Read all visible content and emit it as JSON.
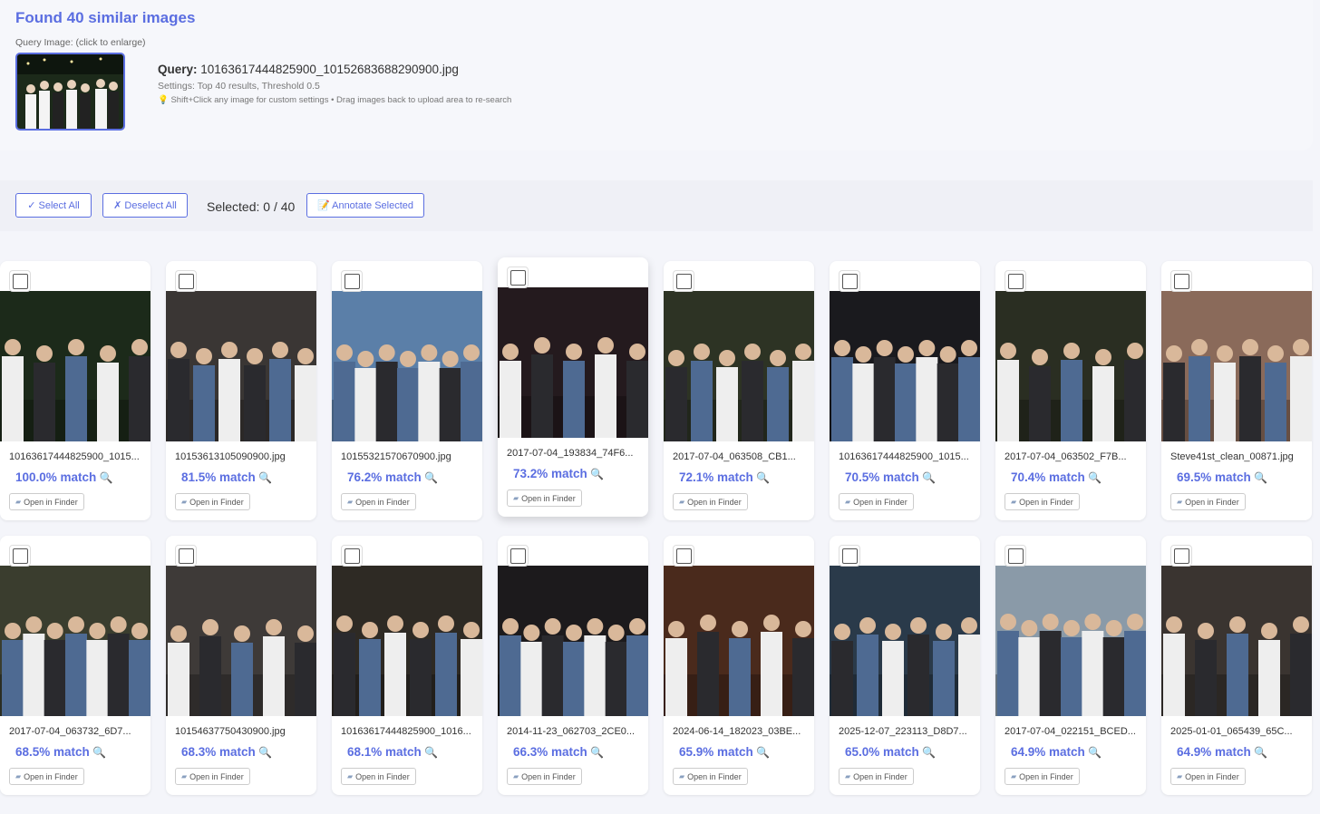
{
  "header": {
    "title": "Found 40 similar images",
    "query_label": "Query Image: (click to enlarge)",
    "query_prefix": "Query:",
    "query_filename": "10163617444825900_10152683688290900.jpg",
    "settings": "Settings: Top 40 results, Threshold 0.5",
    "tip": "💡 Shift+Click any image for custom settings • Drag images back to upload area to re-search"
  },
  "toolbar": {
    "select_all": "✓ Select All",
    "deselect_all": "✗ Deselect All",
    "selected": "Selected: 0 / 40",
    "annotate": "📝 Annotate Selected"
  },
  "open_in_finder": "Open in Finder",
  "results": [
    {
      "filename": "10163617444825900_1015...",
      "match": "100.0% match",
      "photo_color": "#1c2a1a"
    },
    {
      "filename": "10153613105090900.jpg",
      "match": "81.5% match",
      "photo_color": "#3a3634"
    },
    {
      "filename": "10155321570670900.jpg",
      "match": "76.2% match",
      "photo_color": "#5b7fa8"
    },
    {
      "filename": "2017-07-04_193834_74F6...",
      "match": "73.2% match",
      "photo_color": "#241a1e"
    },
    {
      "filename": "2017-07-04_063508_CB1...",
      "match": "72.1% match",
      "photo_color": "#2d3324"
    },
    {
      "filename": "10163617444825900_1015...",
      "match": "70.5% match",
      "photo_color": "#1a1a1e"
    },
    {
      "filename": "2017-07-04_063502_F7B...",
      "match": "70.4% match",
      "photo_color": "#2a2e22"
    },
    {
      "filename": "Steve41st_clean_00871.jpg",
      "match": "69.5% match",
      "photo_color": "#8a6a5a"
    },
    {
      "filename": "2017-07-04_063732_6D7...",
      "match": "68.5% match",
      "photo_color": "#3a3d2e"
    },
    {
      "filename": "10154637750430900.jpg",
      "match": "68.3% match",
      "photo_color": "#3e3a38"
    },
    {
      "filename": "10163617444825900_1016...",
      "match": "68.1% match",
      "photo_color": "#2e2a24"
    },
    {
      "filename": "2014-11-23_062703_2CE0...",
      "match": "66.3% match",
      "photo_color": "#1c1a1c"
    },
    {
      "filename": "2024-06-14_182023_03BE...",
      "match": "65.9% match",
      "photo_color": "#4a2a1c"
    },
    {
      "filename": "2025-12-07_223113_D8D7...",
      "match": "65.0% match",
      "photo_color": "#2a3a4a"
    },
    {
      "filename": "2017-07-04_022151_BCED...",
      "match": "64.9% match",
      "photo_color": "#8a9aa8"
    },
    {
      "filename": "2025-01-01_065439_65C...",
      "match": "64.9% match",
      "photo_color": "#3a3430"
    }
  ]
}
